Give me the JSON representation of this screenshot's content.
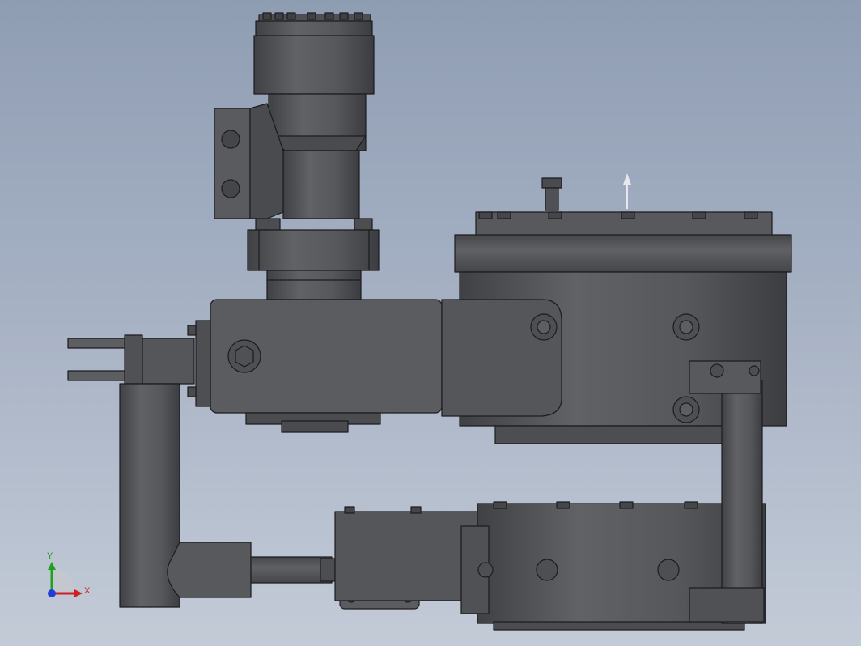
{
  "viewport": {
    "background_top": "#8f9db3",
    "background_bottom": "#c3cbd7"
  },
  "model": {
    "body_color": "#56575a",
    "edge_color": "#1c1c1e",
    "highlight_color": "#6a6b6e"
  },
  "triad": {
    "y_label": "Y",
    "x_label": "X",
    "y_color": "#1fa11f",
    "x_color": "#cc2222",
    "z_color": "#1f3fd6"
  }
}
